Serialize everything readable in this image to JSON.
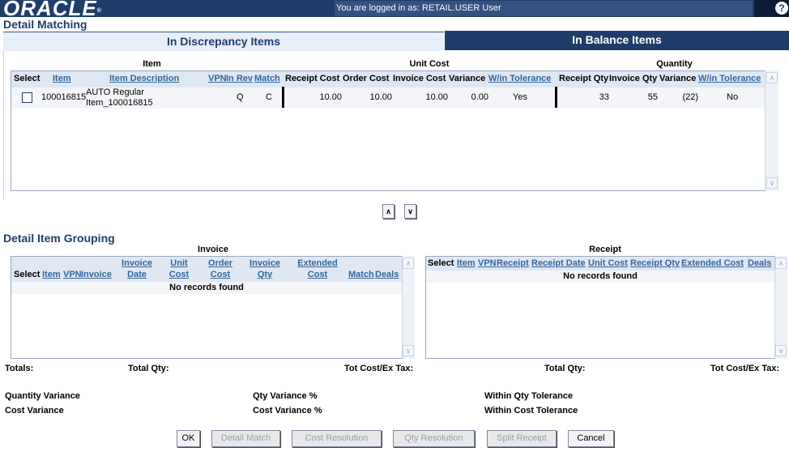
{
  "header": {
    "logo_text": "ORACLE",
    "logged_in_text": "You are logged in as: RETAIL.USER User",
    "help_label": "?"
  },
  "page_title": "Detail Matching",
  "tabs": [
    {
      "label": "In Discrepancy Items",
      "active": true
    },
    {
      "label": "In Balance Items",
      "active": false
    }
  ],
  "discrepancy_table": {
    "groups": {
      "item": "Item",
      "unit_cost": "Unit Cost",
      "quantity": "Quantity"
    },
    "columns": {
      "select": "Select",
      "item": "Item",
      "item_description": "Item Description",
      "vpn": "VPN",
      "in_rev": "In Rev",
      "match": "Match",
      "receipt_cost": "Receipt Cost",
      "order_cost": "Order Cost",
      "invoice_cost": "Invoice Cost",
      "cost_variance": "Variance",
      "cost_within_tolerance": "W/in Tolerance",
      "receipt_qty": "Receipt Qty",
      "invoice_qty": "Invoice Qty",
      "qty_variance": "Variance",
      "qty_within_tolerance": "W/in Tolerance"
    },
    "rows": [
      {
        "item": "100016815",
        "description_line1": "AUTO Regular",
        "description_line2": "Item_100016815",
        "vpn": "",
        "in_rev": "Q",
        "match": "C",
        "receipt_cost": "10.00",
        "order_cost": "10.00",
        "invoice_cost": "10.00",
        "cost_variance": "0.00",
        "cost_within_tolerance": "Yes",
        "receipt_qty": "33",
        "invoice_qty": "55",
        "qty_variance": "(22)",
        "qty_within_tolerance": "No",
        "selected": false
      }
    ]
  },
  "nav_buttons": {
    "up": "∧",
    "down": "∨"
  },
  "detail_grouping": {
    "title": "Detail Item Grouping",
    "invoice": {
      "title": "Invoice",
      "columns": {
        "select": "Select",
        "item": "Item",
        "vpn": "VPN",
        "invoice": "Invoice",
        "invoice_date_1": "Invoice",
        "invoice_date_2": "Date",
        "unit_cost_1": "Unit",
        "unit_cost_2": "Cost",
        "order_cost_1": "Order",
        "order_cost_2": "Cost",
        "invoice_qty_1": "Invoice",
        "invoice_qty_2": "Qty",
        "extended_cost_1": "Extended",
        "extended_cost_2": "Cost",
        "match": "Match",
        "deals": "Deals"
      },
      "empty_text": "No records found"
    },
    "receipt": {
      "title": "Receipt",
      "columns": {
        "select": "Select",
        "item": "Item",
        "vpn": "VPN",
        "receipt": "Receipt",
        "receipt_date": "Receipt Date",
        "unit_cost": "Unit Cost",
        "receipt_qty": "Receipt Qty",
        "extended_cost": "Extended Cost",
        "deals": "Deals"
      },
      "empty_text": "No records found"
    }
  },
  "totals": {
    "totals_label": "Totals:",
    "invoice_total_qty_label": "Total Qty:",
    "invoice_tot_cost_label": "Tot Cost/Ex Tax:",
    "receipt_total_qty_label": "Total Qty:",
    "receipt_tot_cost_label": "Tot Cost/Ex Tax:"
  },
  "variances": {
    "quantity_variance": "Quantity Variance",
    "cost_variance": "Cost Variance",
    "qty_variance_pct": "Qty Variance %",
    "cost_variance_pct": "Cost Variance %",
    "within_qty_tolerance": "Within Qty Tolerance",
    "within_cost_tolerance": "Within Cost Tolerance"
  },
  "buttons": {
    "ok": "OK",
    "detail_match": "Detail Match",
    "cost_resolution": "Cost Resolution",
    "qty_resolution": "Qty Resolution",
    "split_receipt": "Split Receipt",
    "cancel": "Cancel"
  },
  "colors": {
    "header_bg": "#1f3d6b",
    "login_bar_bg": "#34527f",
    "section_title": "#1f3d6b",
    "link": "#336699",
    "table_header_bg": "#dfe7f2"
  }
}
